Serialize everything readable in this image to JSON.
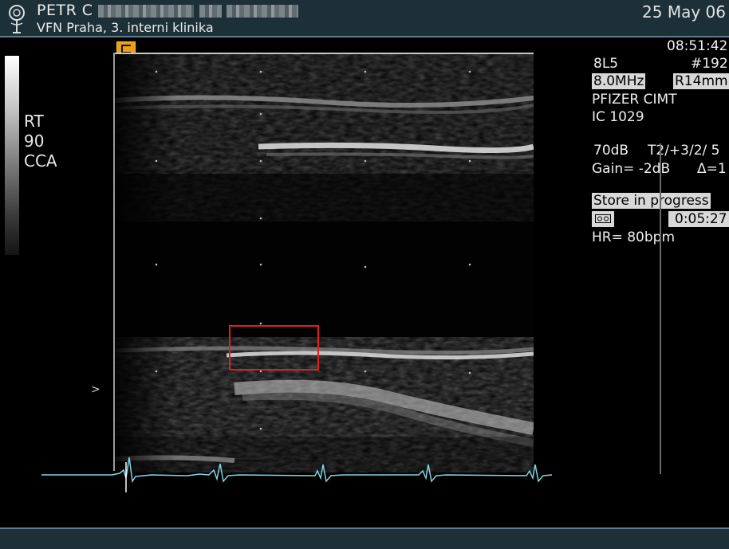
{
  "header": {
    "patient_name": "PETR C",
    "hospital": "VFN  Praha,  3. interni klinika",
    "date": "25 May 06",
    "logo_icon": "ge-logo-icon"
  },
  "grayscale": {
    "labels": [
      "RT",
      "90",
      "CCA"
    ]
  },
  "params": {
    "time": "08:51:42",
    "probe": "8L5",
    "image_no": "#192",
    "frequency": "8.0MHz",
    "range": "R14mm",
    "study": "PFIZER CIMT",
    "id": "IC 1029",
    "dynamic_range": "70dB",
    "mode": "T2/+3/2/ 5",
    "gain": "Gain=  -2dB",
    "delta": "Δ=1",
    "store_status": "Store in progress",
    "elapsed": "0:05:27",
    "heart_rate": "HR=  80bpm",
    "tape_icon": "cassette-icon"
  },
  "colors": {
    "header_bg": "#1d3038",
    "roi": "#e02020",
    "ecg": "#7fd6e6",
    "cine_marker": "#e8a018"
  }
}
